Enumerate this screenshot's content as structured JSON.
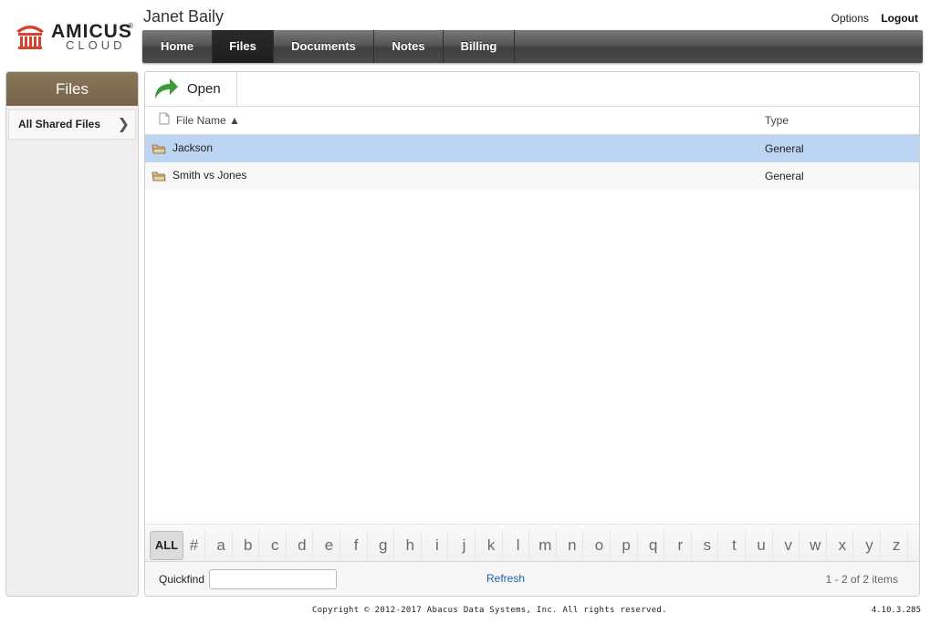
{
  "brand": {
    "name_top": "AMICUS",
    "name_bottom": "CLOUD",
    "reg_mark": "®",
    "logo_color": "#d9412f"
  },
  "header": {
    "user_name": "Janet Baily",
    "options_label": "Options",
    "logout_label": "Logout"
  },
  "nav": {
    "items": [
      {
        "label": "Home",
        "active": false
      },
      {
        "label": "Files",
        "active": true
      },
      {
        "label": "Documents",
        "active": false
      },
      {
        "label": "Notes",
        "active": false
      },
      {
        "label": "Billing",
        "active": false
      }
    ]
  },
  "sidebar": {
    "title": "Files",
    "items": [
      {
        "label": "All Shared Files",
        "icon": "chevron-right-icon"
      }
    ]
  },
  "toolbar": {
    "open_label": "Open",
    "open_icon": "forward-arrow-icon"
  },
  "grid": {
    "columns": {
      "name": "File Name ▲",
      "type": "Type"
    },
    "rows": [
      {
        "name": "Jackson",
        "type": "General",
        "selected": true
      },
      {
        "name": "Smith vs Jones",
        "type": "General",
        "selected": false
      }
    ]
  },
  "alpha": {
    "all_label": "ALL",
    "letters": [
      "#",
      "a",
      "b",
      "c",
      "d",
      "e",
      "f",
      "g",
      "h",
      "i",
      "j",
      "k",
      "l",
      "m",
      "n",
      "o",
      "p",
      "q",
      "r",
      "s",
      "t",
      "u",
      "v",
      "w",
      "x",
      "y",
      "z"
    ]
  },
  "footer": {
    "quickfind_label": "Quickfind",
    "quickfind_value": "",
    "refresh_label": "Refresh",
    "count_text": "1 - 2 of 2 items"
  },
  "page_footer": {
    "copyright": "Copyright © 2012-2017 Abacus Data Systems, Inc. All rights reserved.",
    "version": "4.10.3.285"
  }
}
